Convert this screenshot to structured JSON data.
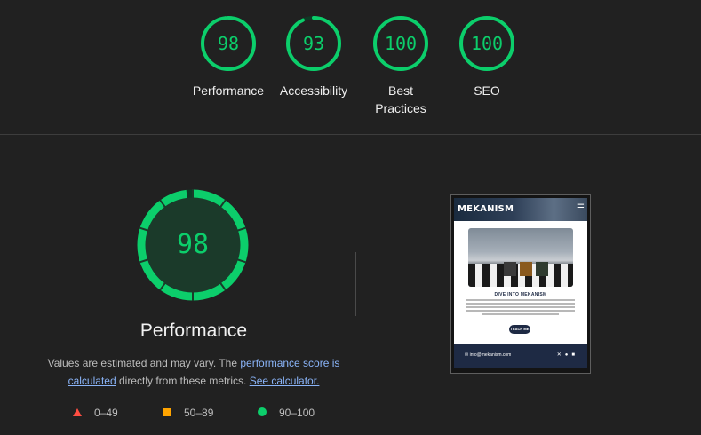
{
  "colors": {
    "pass": "#0cce6b",
    "average": "#ffa400",
    "fail": "#ff4e42",
    "background": "#212121",
    "link": "#8ab4f8"
  },
  "categories": [
    {
      "label": "Performance",
      "score": "98",
      "fraction": 0.98
    },
    {
      "label": "Accessibility",
      "score": "93",
      "fraction": 0.93
    },
    {
      "label": "Best Practices",
      "score": "100",
      "fraction": 1.0
    },
    {
      "label": "SEO",
      "score": "100",
      "fraction": 1.0
    }
  ],
  "main": {
    "score": "98",
    "fraction": 0.98,
    "title": "Performance",
    "desc_prefix": "Values are estimated and may vary. The ",
    "link_score": "performance score is calculated",
    "desc_middle": " directly from these metrics. ",
    "link_calc": "See calculator."
  },
  "legend": [
    {
      "icon": "triangle-icon",
      "range": "0–49"
    },
    {
      "icon": "square-icon",
      "range": "50–89"
    },
    {
      "icon": "circle-icon",
      "range": "90–100"
    }
  ],
  "screenshot": {
    "logo": "MEKANISM",
    "menu_icon": "hamburger-icon",
    "heading": "DIVE INTO MEKANISM",
    "button": "TEACH ME",
    "footer_email": "info@mekanism.com",
    "footer_icons": [
      "x-icon",
      "github-icon",
      "linkedin-icon"
    ]
  }
}
